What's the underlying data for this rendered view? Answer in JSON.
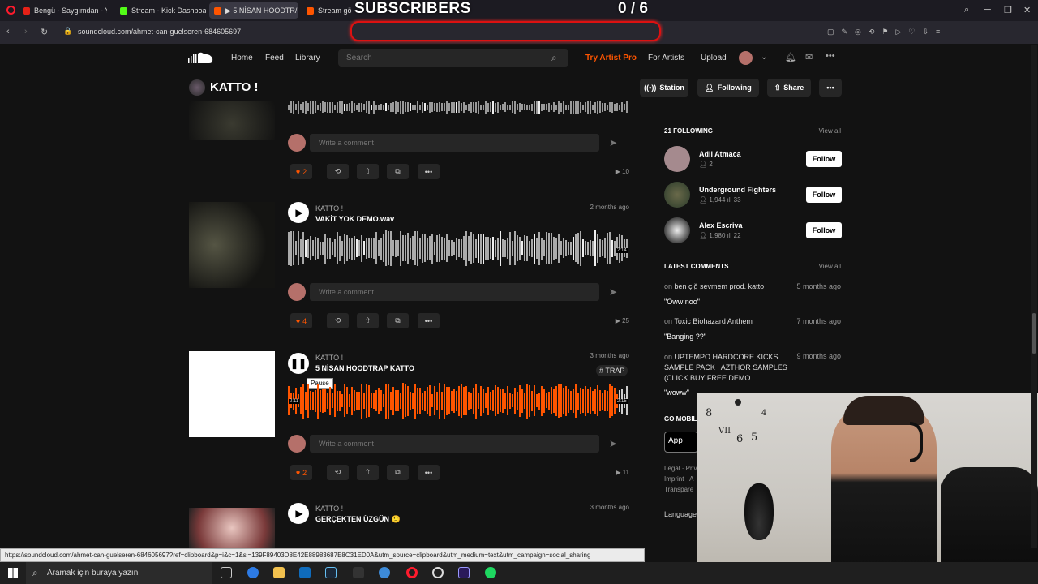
{
  "browser": {
    "tabs": [
      {
        "label": "Bengü - Saygımdan - You",
        "color": "#e62117"
      },
      {
        "label": "Stream - Kick Dashboard",
        "color": "#53fc18"
      },
      {
        "label": "▶ 5 NİSAN HOODTR/",
        "color": "#ff5500"
      },
      {
        "label": "Stream gökc",
        "color": "#ff5500"
      }
    ],
    "url": "soundcloud.com/ahmet-can-guelseren-684605697",
    "status_url": "https://soundcloud.com/ahmet-can-guelseren-684605697?ref=clipboard&p=i&c=1&si=139F89403D8E42E88983687E8C31ED0A&utm_source=clipboard&utm_medium=text&utm_campaign=social_sharing"
  },
  "overlay": {
    "title": "SUBSCRIBERS",
    "count": "0 / 6"
  },
  "header": {
    "nav": [
      "Home",
      "Feed",
      "Library"
    ],
    "search_placeholder": "Search",
    "try_pro": "Try Artist Pro",
    "for_artists": "For Artists",
    "upload": "Upload"
  },
  "profile": {
    "name": "KATTO !",
    "station": "Station",
    "following": "Following",
    "share": "Share"
  },
  "tracks": [
    {
      "likes": "2",
      "plays": "10",
      "comment_placeholder": "Write a comment"
    },
    {
      "artist": "KATTO !",
      "title": "VAKİT YOK DEMO.wav",
      "date": "2 months ago",
      "likes": "4",
      "plays": "25",
      "comment_placeholder": "Write a comment",
      "duration": "2:14"
    },
    {
      "artist": "KATTO !",
      "title": "5 NİSAN HOODTRAP KATTO",
      "date": "3 months ago",
      "tag": "# TRAP",
      "likes": "2",
      "plays": "11",
      "comment_placeholder": "Write a comment",
      "tooltip": "Pause",
      "elapsed": "2:11",
      "duration": "2:15",
      "progress": 0.97
    },
    {
      "artist": "KATTO !",
      "title": "GERÇEKTEN ÜZGÜN 🙁",
      "date": "3 months ago"
    }
  ],
  "sidebar": {
    "following_head": "21 FOLLOWING",
    "view_all": "View all",
    "follow_label": "Follow",
    "following": [
      {
        "name": "Adil Atmaca",
        "followers": "2",
        "tracks": ""
      },
      {
        "name": "Underground Fighters",
        "followers": "1,944",
        "tracks": "33"
      },
      {
        "name": "Alex Escriva",
        "followers": "1,980",
        "tracks": "22"
      }
    ],
    "comments_head": "LATEST COMMENTS",
    "comments": [
      {
        "on": "on",
        "track": "ben çiğ sevmem prod. katto",
        "time": "5 months ago",
        "text": "\"Oww noo\""
      },
      {
        "on": "on",
        "track": "Toxic Biohazard Anthem",
        "time": "7 months ago",
        "text": "\"Banging ??\""
      },
      {
        "on": "on",
        "track": "UPTEMPO HARDCORE KICKS SAMPLE PACK | AZTHOR SAMPLES (CLICK BUY FREE DEMO",
        "time": "9 months ago",
        "text": "\"woww\""
      }
    ],
    "go_mobile": "GO MOBILE",
    "legal": "Legal · Priv",
    "imprint": "Imprint · A",
    "transparency": "Transpare",
    "language": "Language"
  },
  "taskbar": {
    "search": "Aramak için buraya yazın"
  },
  "colors": {
    "accent": "#ff5500",
    "background": "#121212"
  }
}
